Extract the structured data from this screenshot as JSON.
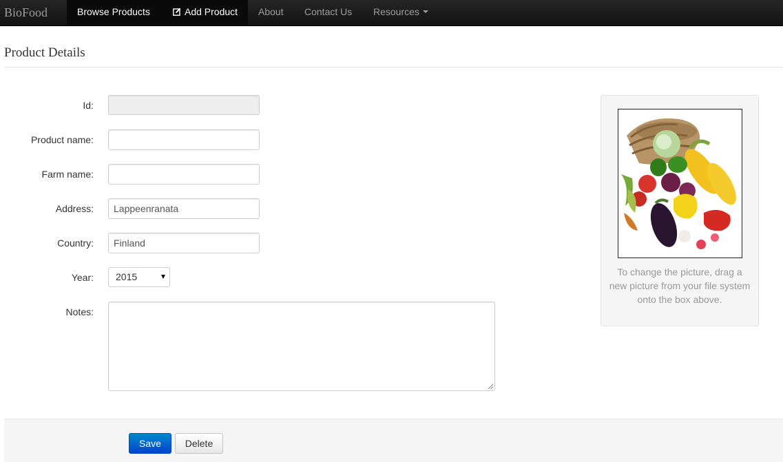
{
  "navbar": {
    "brand": "BioFood",
    "items": [
      {
        "label": "Browse Products",
        "active": true
      },
      {
        "label": "Add Product",
        "active": true,
        "icon": "edit-icon"
      },
      {
        "label": "About",
        "active": false
      },
      {
        "label": "Contact Us",
        "active": false
      },
      {
        "label": "Resources",
        "active": false,
        "icon": "caret-down-icon"
      }
    ]
  },
  "page": {
    "title": "Product Details"
  },
  "form": {
    "id": {
      "label": "Id:",
      "value": "",
      "disabled": true
    },
    "product_name": {
      "label": "Product name:",
      "value": ""
    },
    "farm_name": {
      "label": "Farm name:",
      "value": ""
    },
    "address": {
      "label": "Address:",
      "value": "Lappeenranata"
    },
    "country": {
      "label": "Country:",
      "value": "Finland"
    },
    "year": {
      "label": "Year:",
      "value": "2015"
    },
    "notes": {
      "label": "Notes:",
      "value": ""
    }
  },
  "picture": {
    "caption": "To change the picture, drag a new picture from your file system onto the box above."
  },
  "actions": {
    "save_label": "Save",
    "delete_label": "Delete"
  },
  "colors": {
    "navbar_bg": "#1b1b1b",
    "primary": "#0055cc",
    "muted_text": "#999999"
  }
}
